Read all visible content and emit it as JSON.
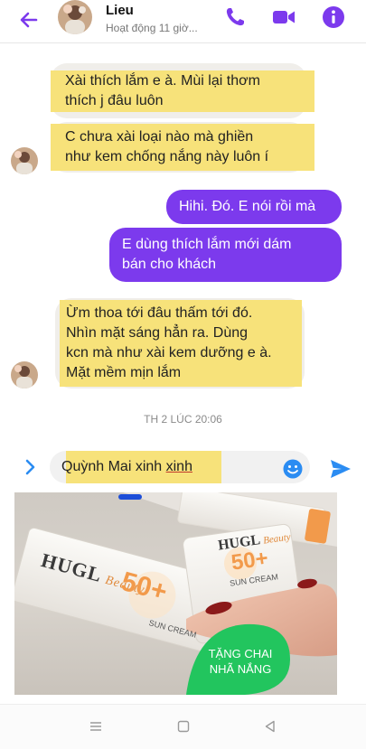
{
  "header": {
    "contact_name": "Lieu",
    "status": "Hoạt động 11 giờ..."
  },
  "colors": {
    "accent": "#7c3aed",
    "messenger_blue": "#2b8cf2",
    "highlight": "#f7e27a",
    "incoming_bubble": "#f0eeea",
    "promo_badge": "#22c55e"
  },
  "messages": [
    {
      "from": "them",
      "text_lines": [
        "Xài thích lắm e à. Mùi lại thơm",
        "thích j đâu luôn"
      ]
    },
    {
      "from": "them",
      "text_lines": [
        "C chưa xài loại nào mà ghiền",
        "như kem chống nắng này luôn í"
      ]
    },
    {
      "from": "me",
      "text": "Hihi. Đó. E nói rồi mà"
    },
    {
      "from": "me",
      "text_lines": [
        "E dùng thích lắm mới dám",
        "bán  cho khách"
      ]
    },
    {
      "from": "them",
      "text_lines": [
        "Ừm thoa tới đâu thấm tới đó.",
        "Nhìn mặt sáng hẳn ra. Dùng",
        "kcn mà như xài kem dưỡng e à.",
        "Mặt mềm mịn lắm"
      ]
    }
  ],
  "timestamp": "TH 2 LÚC 20:06",
  "composer": {
    "text_main": "Quỳnh Mai xinh ",
    "text_underlined": "xinh"
  },
  "promo": {
    "brand": "HUGL",
    "brand_script": "Beauty",
    "spf": "50+",
    "product_name": "SUN CREAM",
    "badge_line1": "TẶNG CHAI",
    "badge_line2": "NHÃ NẮNG"
  },
  "icons": {
    "back": "arrow-left-icon",
    "call": "phone-icon",
    "video": "video-camera-icon",
    "info": "info-icon",
    "expand": "chevron-right-icon",
    "emoji": "smiley-icon",
    "send": "send-icon",
    "nav_menu": "menu-icon",
    "nav_home": "square-icon",
    "nav_back": "triangle-back-icon"
  }
}
